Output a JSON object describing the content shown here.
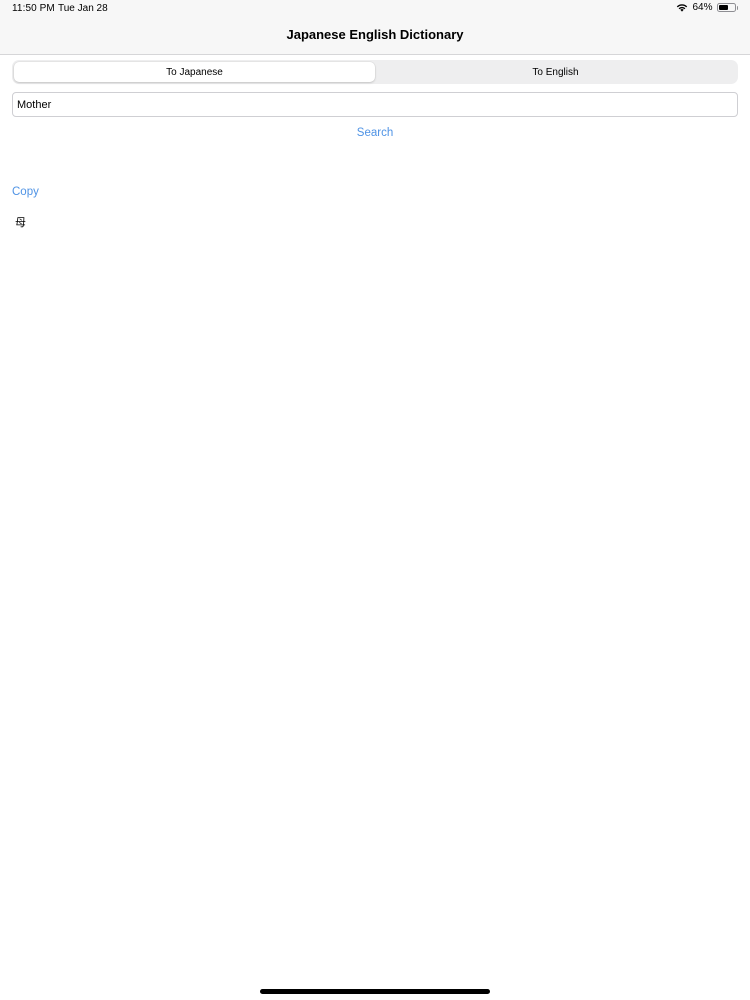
{
  "status_bar": {
    "time": "11:50 PM",
    "date": "Tue Jan 28",
    "battery_label": "64%",
    "battery_level": 0.64,
    "icons": [
      "wifi-icon",
      "battery-icon"
    ]
  },
  "nav": {
    "title": "Japanese English Dictionary"
  },
  "segmented": {
    "options": [
      "To Japanese",
      "To English"
    ],
    "selected": "To Japanese"
  },
  "search": {
    "value": "Mother",
    "button_label": "Search"
  },
  "result": {
    "copy_label": "Copy",
    "text": "母"
  },
  "colors": {
    "link": "#4f93e5",
    "bar_background": "#f7f7f7",
    "segment_track": "#eeeeef"
  }
}
